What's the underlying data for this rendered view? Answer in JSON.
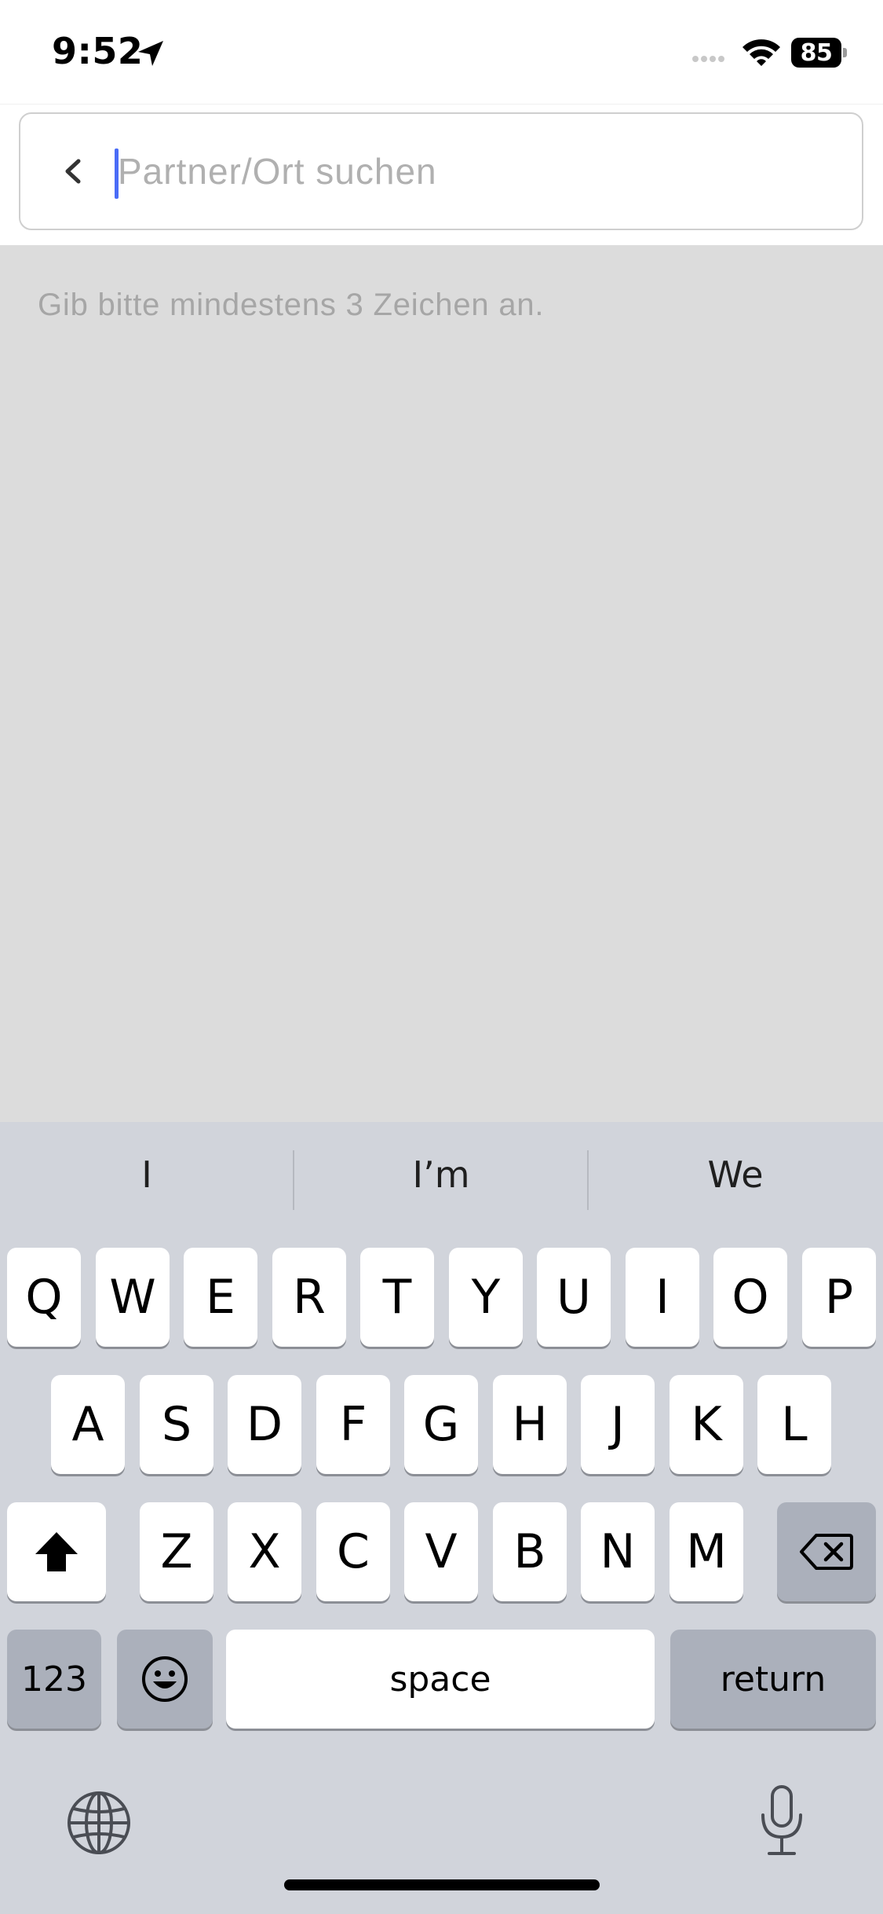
{
  "status_bar": {
    "time": "9:52",
    "battery_level": "85",
    "icons": [
      "location-arrow-icon",
      "cellular-signal-icon",
      "wifi-icon",
      "battery-icon"
    ]
  },
  "search": {
    "placeholder": "Partner/Ort suchen",
    "value": "",
    "back_icon": "chevron-left-icon"
  },
  "content": {
    "hint": "Gib bitte mindestens 3 Zeichen an."
  },
  "keyboard": {
    "suggestions": [
      "I",
      "I’m",
      "We"
    ],
    "row1": [
      "Q",
      "W",
      "E",
      "R",
      "T",
      "Y",
      "U",
      "I",
      "O",
      "P"
    ],
    "row2": [
      "A",
      "S",
      "D",
      "F",
      "G",
      "H",
      "J",
      "K",
      "L"
    ],
    "row3": [
      "Z",
      "X",
      "C",
      "V",
      "B",
      "N",
      "M"
    ],
    "numbers_label": "123",
    "space_label": "space",
    "return_label": "return",
    "icons": [
      "shift-icon",
      "delete-icon",
      "emoji-icon",
      "globe-icon",
      "microphone-icon"
    ]
  },
  "colors": {
    "accent": "#4a6cf7",
    "content_background": "#dcdcdc",
    "keyboard_background": "#d1d4db"
  }
}
